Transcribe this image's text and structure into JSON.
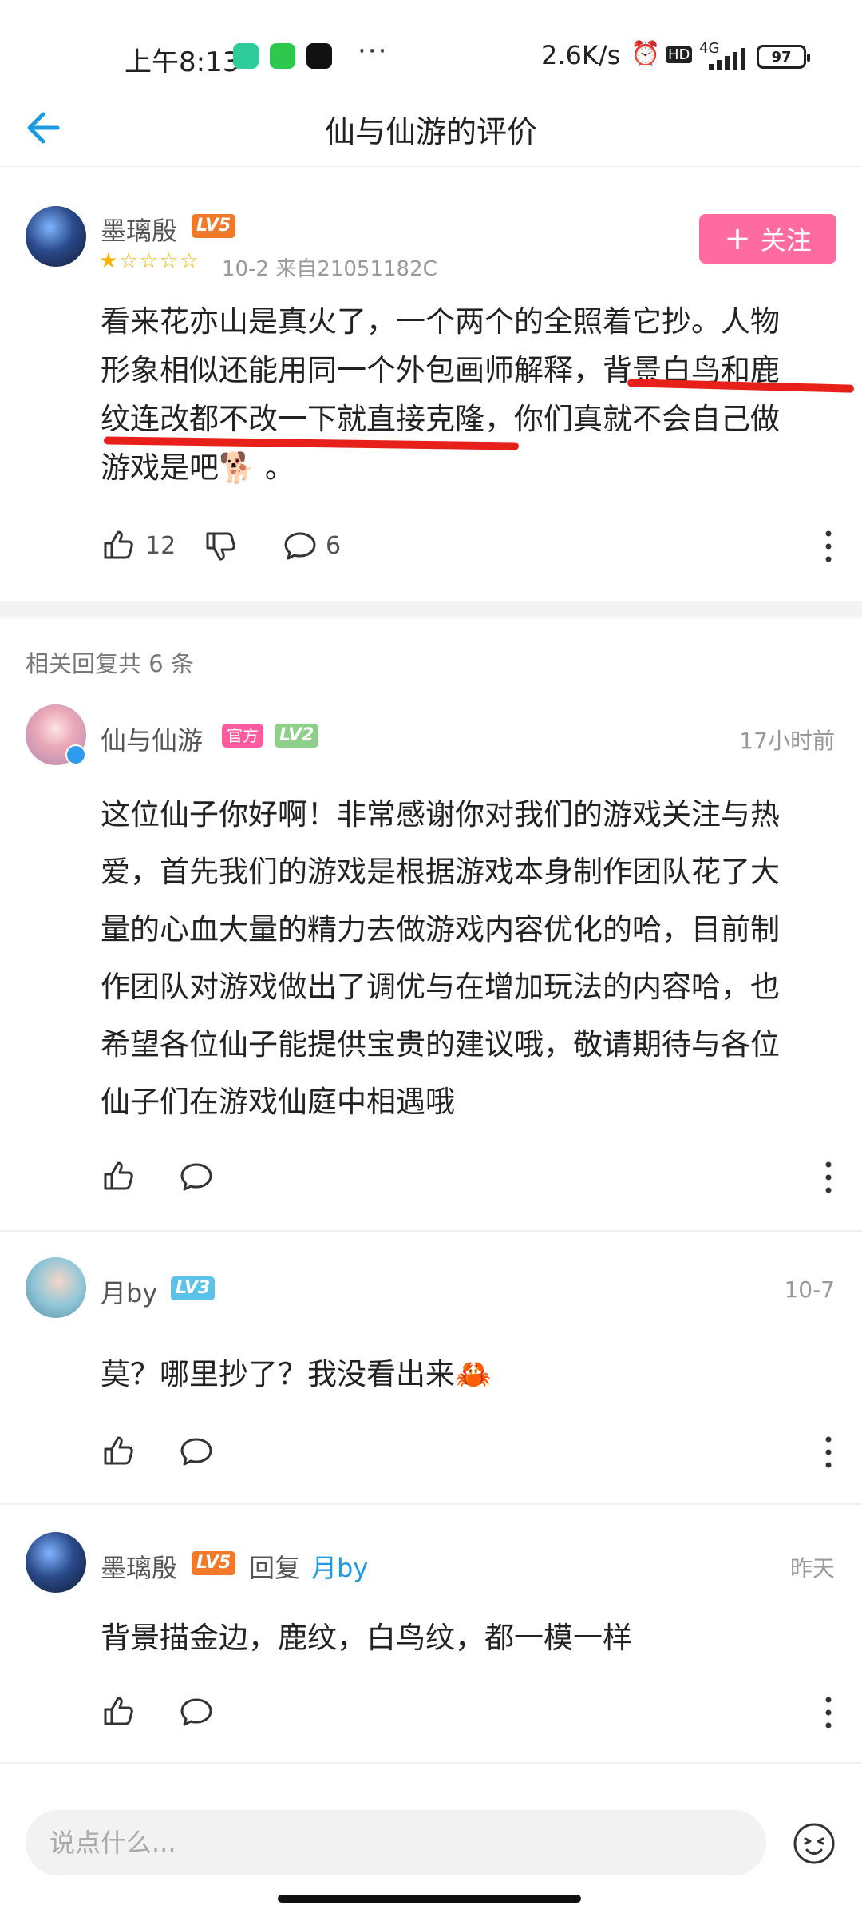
{
  "status_bar": {
    "time": "上午8:13",
    "net_speed": "2.6K/s",
    "battery": "97",
    "network": "4G",
    "hd": "HD"
  },
  "header": {
    "title": "仙与仙游的评价"
  },
  "main_review": {
    "username": "墨璃殷",
    "level": "LV5",
    "rating": 1,
    "meta": "10-2 来自21051182C",
    "follow_label": "关注",
    "text_lines": [
      "看来花亦山是真火了，一个两个的全照着它抄。人物",
      "形象相似还能用同一个外包画师解释，背景白鸟和鹿",
      "纹连改都不改一下就直接克隆，你们真就不会自己做",
      "游戏是吧🐕 。"
    ],
    "likes": "12",
    "comments": "6"
  },
  "replies_header": "相关回复共 6 条",
  "replies": [
    {
      "username": "仙与仙游",
      "official_tag": "官方",
      "level": "LV2",
      "time": "17小时前",
      "text_lines": [
        "这位仙子你好啊！非常感谢你对我们的游戏关注与热",
        "爱，首先我们的游戏是根据游戏本身制作团队花了大",
        "量的心血大量的精力去做游戏内容优化的哈，目前制",
        "作团队对游戏做出了调优与在增加玩法的内容哈，也",
        "希望各位仙子能提供宝贵的建议哦，敬请期待与各位",
        "仙子们在游戏仙庭中相遇哦"
      ]
    },
    {
      "username": "月by",
      "level": "LV3",
      "time": "10-7",
      "text_lines": [
        "莫？哪里抄了？我没看出来🦀"
      ]
    },
    {
      "username": "墨璃殷",
      "level": "LV5",
      "reply_word": "回复",
      "reply_to": "月by",
      "time": "昨天",
      "text_lines": [
        "背景描金边，鹿纹，白鸟纹，都一模一样"
      ]
    }
  ],
  "input": {
    "placeholder": "说点什么..."
  },
  "colors": {
    "accent_blue": "#1e9be0",
    "follow_pink": "#ff6aa0",
    "underline_red": "#e8201a"
  }
}
